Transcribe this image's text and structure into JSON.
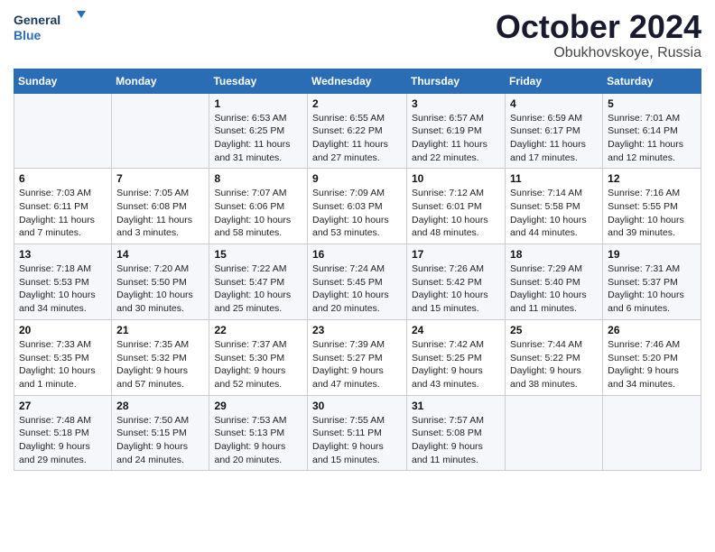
{
  "header": {
    "logo_line1": "General",
    "logo_line2": "Blue",
    "month": "October 2024",
    "location": "Obukhovskoye, Russia"
  },
  "weekdays": [
    "Sunday",
    "Monday",
    "Tuesday",
    "Wednesday",
    "Thursday",
    "Friday",
    "Saturday"
  ],
  "weeks": [
    [
      {
        "day": "",
        "info": ""
      },
      {
        "day": "",
        "info": ""
      },
      {
        "day": "1",
        "info": "Sunrise: 6:53 AM\nSunset: 6:25 PM\nDaylight: 11 hours and 31 minutes."
      },
      {
        "day": "2",
        "info": "Sunrise: 6:55 AM\nSunset: 6:22 PM\nDaylight: 11 hours and 27 minutes."
      },
      {
        "day": "3",
        "info": "Sunrise: 6:57 AM\nSunset: 6:19 PM\nDaylight: 11 hours and 22 minutes."
      },
      {
        "day": "4",
        "info": "Sunrise: 6:59 AM\nSunset: 6:17 PM\nDaylight: 11 hours and 17 minutes."
      },
      {
        "day": "5",
        "info": "Sunrise: 7:01 AM\nSunset: 6:14 PM\nDaylight: 11 hours and 12 minutes."
      }
    ],
    [
      {
        "day": "6",
        "info": "Sunrise: 7:03 AM\nSunset: 6:11 PM\nDaylight: 11 hours and 7 minutes."
      },
      {
        "day": "7",
        "info": "Sunrise: 7:05 AM\nSunset: 6:08 PM\nDaylight: 11 hours and 3 minutes."
      },
      {
        "day": "8",
        "info": "Sunrise: 7:07 AM\nSunset: 6:06 PM\nDaylight: 10 hours and 58 minutes."
      },
      {
        "day": "9",
        "info": "Sunrise: 7:09 AM\nSunset: 6:03 PM\nDaylight: 10 hours and 53 minutes."
      },
      {
        "day": "10",
        "info": "Sunrise: 7:12 AM\nSunset: 6:01 PM\nDaylight: 10 hours and 48 minutes."
      },
      {
        "day": "11",
        "info": "Sunrise: 7:14 AM\nSunset: 5:58 PM\nDaylight: 10 hours and 44 minutes."
      },
      {
        "day": "12",
        "info": "Sunrise: 7:16 AM\nSunset: 5:55 PM\nDaylight: 10 hours and 39 minutes."
      }
    ],
    [
      {
        "day": "13",
        "info": "Sunrise: 7:18 AM\nSunset: 5:53 PM\nDaylight: 10 hours and 34 minutes."
      },
      {
        "day": "14",
        "info": "Sunrise: 7:20 AM\nSunset: 5:50 PM\nDaylight: 10 hours and 30 minutes."
      },
      {
        "day": "15",
        "info": "Sunrise: 7:22 AM\nSunset: 5:47 PM\nDaylight: 10 hours and 25 minutes."
      },
      {
        "day": "16",
        "info": "Sunrise: 7:24 AM\nSunset: 5:45 PM\nDaylight: 10 hours and 20 minutes."
      },
      {
        "day": "17",
        "info": "Sunrise: 7:26 AM\nSunset: 5:42 PM\nDaylight: 10 hours and 15 minutes."
      },
      {
        "day": "18",
        "info": "Sunrise: 7:29 AM\nSunset: 5:40 PM\nDaylight: 10 hours and 11 minutes."
      },
      {
        "day": "19",
        "info": "Sunrise: 7:31 AM\nSunset: 5:37 PM\nDaylight: 10 hours and 6 minutes."
      }
    ],
    [
      {
        "day": "20",
        "info": "Sunrise: 7:33 AM\nSunset: 5:35 PM\nDaylight: 10 hours and 1 minute."
      },
      {
        "day": "21",
        "info": "Sunrise: 7:35 AM\nSunset: 5:32 PM\nDaylight: 9 hours and 57 minutes."
      },
      {
        "day": "22",
        "info": "Sunrise: 7:37 AM\nSunset: 5:30 PM\nDaylight: 9 hours and 52 minutes."
      },
      {
        "day": "23",
        "info": "Sunrise: 7:39 AM\nSunset: 5:27 PM\nDaylight: 9 hours and 47 minutes."
      },
      {
        "day": "24",
        "info": "Sunrise: 7:42 AM\nSunset: 5:25 PM\nDaylight: 9 hours and 43 minutes."
      },
      {
        "day": "25",
        "info": "Sunrise: 7:44 AM\nSunset: 5:22 PM\nDaylight: 9 hours and 38 minutes."
      },
      {
        "day": "26",
        "info": "Sunrise: 7:46 AM\nSunset: 5:20 PM\nDaylight: 9 hours and 34 minutes."
      }
    ],
    [
      {
        "day": "27",
        "info": "Sunrise: 7:48 AM\nSunset: 5:18 PM\nDaylight: 9 hours and 29 minutes."
      },
      {
        "day": "28",
        "info": "Sunrise: 7:50 AM\nSunset: 5:15 PM\nDaylight: 9 hours and 24 minutes."
      },
      {
        "day": "29",
        "info": "Sunrise: 7:53 AM\nSunset: 5:13 PM\nDaylight: 9 hours and 20 minutes."
      },
      {
        "day": "30",
        "info": "Sunrise: 7:55 AM\nSunset: 5:11 PM\nDaylight: 9 hours and 15 minutes."
      },
      {
        "day": "31",
        "info": "Sunrise: 7:57 AM\nSunset: 5:08 PM\nDaylight: 9 hours and 11 minutes."
      },
      {
        "day": "",
        "info": ""
      },
      {
        "day": "",
        "info": ""
      }
    ]
  ]
}
